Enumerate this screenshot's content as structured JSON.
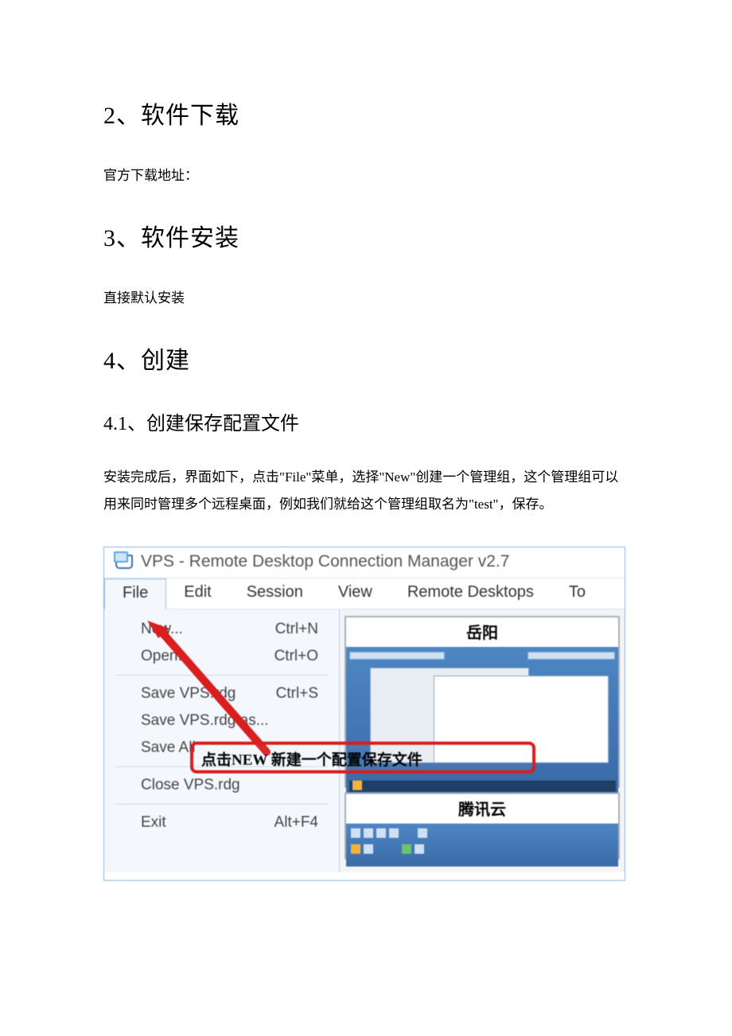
{
  "doc": {
    "h2a": "2、软件下载",
    "p1": "官方下载地址：",
    "h2b": "3、软件安装",
    "p2": "直接默认安装",
    "h2c": "4、创建",
    "h3a": "4.1、创建保存配置文件",
    "p3": "安装完成后，界面如下，点击\"File\"菜单，选择\"New\"创建一个管理组，这个管理组可以用来同时管理多个远程桌面，例如我们就给这个管理组取名为\"test\"，保存。"
  },
  "app": {
    "title": "VPS - Remote Desktop Connection Manager v2.7",
    "menu": [
      "File",
      "Edit",
      "Session",
      "View",
      "Remote Desktops",
      "To"
    ],
    "file_menu": [
      {
        "label": "New...",
        "accel": "Ctrl+N"
      },
      {
        "label": "Open...",
        "accel": "Ctrl+O"
      },
      {
        "divider": true
      },
      {
        "label": "Save VPS.rdg",
        "accel": "Ctrl+S"
      },
      {
        "label": "Save VPS.rdg as...",
        "accel": ""
      },
      {
        "label": "Save All",
        "accel": ""
      },
      {
        "divider": true
      },
      {
        "label": "Close VPS.rdg",
        "accel": ""
      },
      {
        "divider": true
      },
      {
        "label": "Exit",
        "accel": "Alt+F4"
      }
    ],
    "thumbs": [
      "岳阳",
      "腾讯云"
    ],
    "callout": "点击NEW 新建一个配置保存文件"
  }
}
